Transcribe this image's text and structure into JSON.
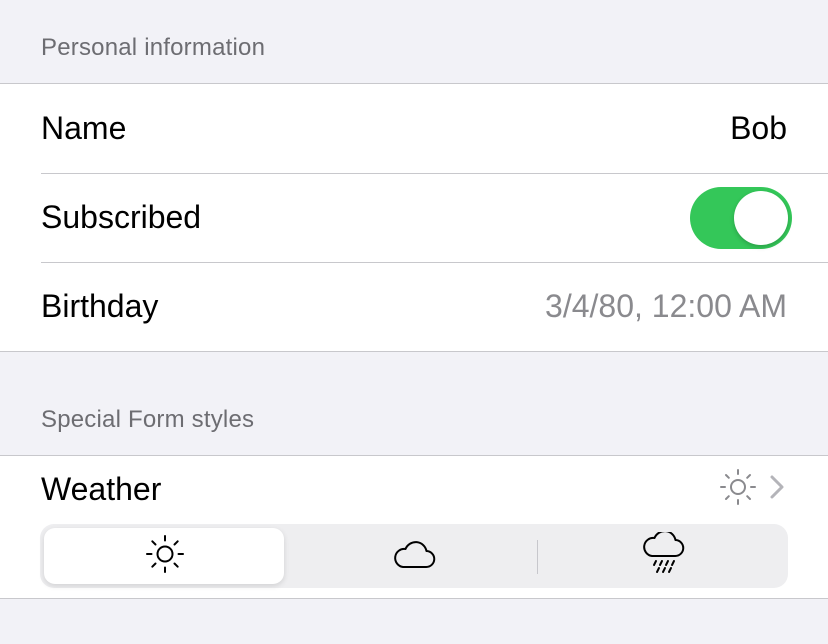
{
  "personal": {
    "header": "Personal information",
    "name_label": "Name",
    "name_value": "Bob",
    "subscribed_label": "Subscribed",
    "subscribed_on": true,
    "birthday_label": "Birthday",
    "birthday_value": "3/4/80, 12:00 AM"
  },
  "special": {
    "header": "Special Form styles",
    "weather_label": "Weather",
    "weather_selected_icon": "sun-icon",
    "segments": [
      {
        "icon": "sun-icon",
        "selected": true
      },
      {
        "icon": "cloud-icon",
        "selected": false
      },
      {
        "icon": "rain-cloud-icon",
        "selected": false
      }
    ]
  },
  "colors": {
    "background": "#f2f2f7",
    "toggle_on": "#34c759",
    "secondary_text": "#8a8a8e",
    "header_text": "#6d6d72"
  }
}
